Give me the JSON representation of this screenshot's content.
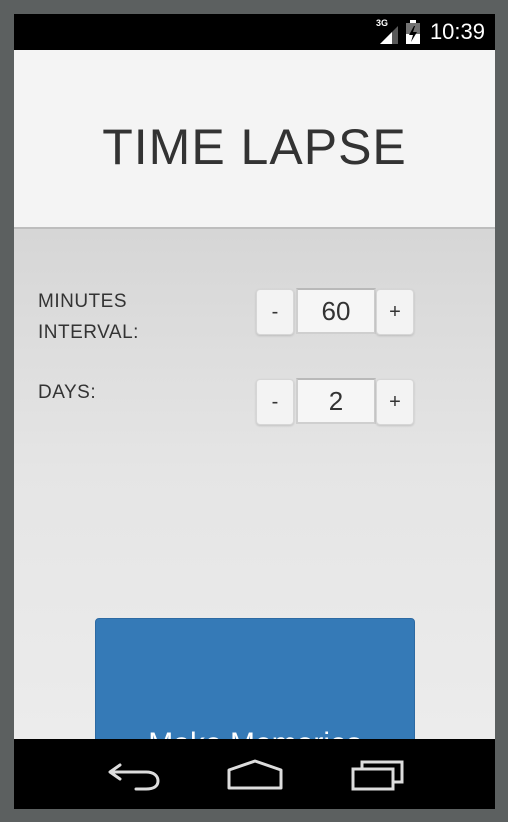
{
  "status_bar": {
    "network_type": "3G",
    "time": "10:39",
    "icons": [
      "signal-icon",
      "battery-charging-icon"
    ]
  },
  "header": {
    "title": "TIME LAPSE"
  },
  "settings": {
    "minutes": {
      "label_line1": "MINUTES",
      "label_line2": "INTERVAL:",
      "decrement_label": "-",
      "value": "60",
      "increment_label": "+"
    },
    "days": {
      "label": "DAYS:",
      "decrement_label": "-",
      "value": "2",
      "increment_label": "+"
    }
  },
  "action": {
    "button_label": "Make Memories"
  },
  "nav_bar": {
    "icons": [
      "back-icon",
      "home-icon",
      "recent-apps-icon"
    ]
  },
  "colors": {
    "accent": "#357ab7",
    "header_bg": "#f4f4f4",
    "bar_bg": "#000000"
  }
}
